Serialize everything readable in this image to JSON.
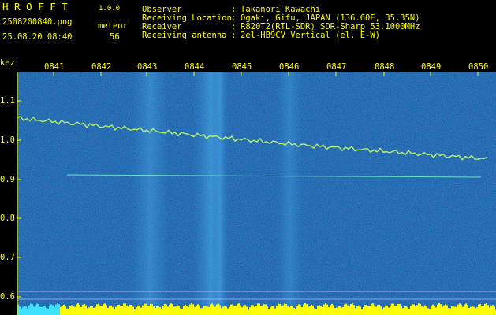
{
  "header": {
    "app_title": "H R O F F T",
    "version": "1.0.0",
    "filename": "2508200840.png",
    "datetime": "25.08.20 08:40",
    "mode_label": "meteor",
    "count": "56",
    "info_labels": [
      "Observer",
      "Receiving Location",
      "Receiver",
      "Receiving antenna"
    ],
    "info_seps": [
      ":",
      ":",
      ":",
      ":"
    ],
    "info_values": [
      "Takanori Kawachi",
      "Ogaki, Gifu, JAPAN (136.60E, 35.35N)",
      "R820T2(RTL-SDR) SDR-Sharp 53.1000MHz",
      "2el-HB9CV Vertical (el. E-W)"
    ]
  },
  "axes": {
    "y_unit": "kHz",
    "y_ticks": [
      "1.1",
      "1.0",
      "0.9",
      "0.8",
      "0.7",
      "0.6"
    ],
    "x_ticks": [
      "0841",
      "0842",
      "0843",
      "0844",
      "0845",
      "0846",
      "0847",
      "0848",
      "0849",
      "0850"
    ]
  },
  "colors": {
    "background": "#000000",
    "text": "#ffff00",
    "spectrum_bg": "#0a1a8c",
    "signal": "#40e0ff",
    "trace": "#c8ff60",
    "marker": "#ffff00"
  }
}
